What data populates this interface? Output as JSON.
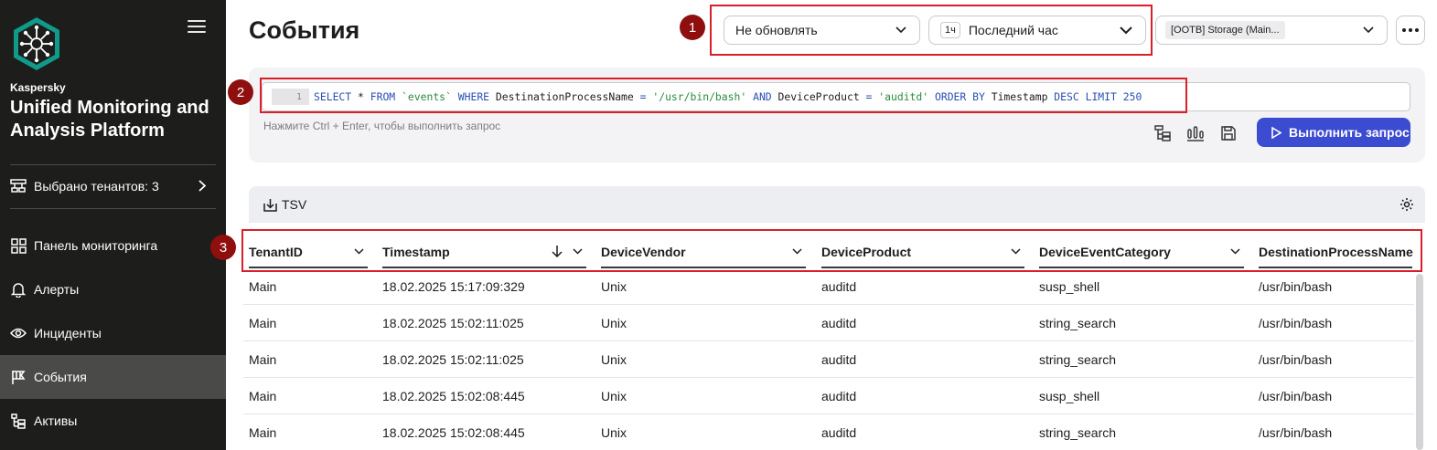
{
  "sidebar": {
    "brand_small": "Kaspersky",
    "brand_title": "Unified Monitoring and Analysis Platform",
    "tenant_label": "Выбрано тенантов: 3",
    "items": [
      {
        "label": "Панель мониторинга",
        "icon": "dashboard-icon"
      },
      {
        "label": "Алерты",
        "icon": "bell-icon"
      },
      {
        "label": "Инциденты",
        "icon": "eye-icon"
      },
      {
        "label": "События",
        "icon": "flag-icon",
        "active": true
      },
      {
        "label": "Активы",
        "icon": "tree-icon"
      }
    ]
  },
  "header": {
    "title": "События",
    "refresh_select": "Не обновлять",
    "period_badge": "1ч",
    "period_select": "Последний час",
    "storage_select": "[OOTB] Storage (Main..."
  },
  "query": {
    "line_number": "1",
    "tokens": [
      {
        "t": "SELECT",
        "k": "kw"
      },
      {
        "t": " * ",
        "k": "id"
      },
      {
        "t": "FROM",
        "k": "kw"
      },
      {
        "t": " `events` ",
        "k": "str"
      },
      {
        "t": "WHERE",
        "k": "kw"
      },
      {
        "t": " DestinationProcessName ",
        "k": "id"
      },
      {
        "t": "=",
        "k": "kw"
      },
      {
        "t": " '/usr/bin/bash' ",
        "k": "str"
      },
      {
        "t": "AND",
        "k": "kw"
      },
      {
        "t": " DeviceProduct ",
        "k": "id"
      },
      {
        "t": "=",
        "k": "kw"
      },
      {
        "t": " 'auditd' ",
        "k": "str"
      },
      {
        "t": "ORDER BY",
        "k": "kw"
      },
      {
        "t": " Timestamp ",
        "k": "id"
      },
      {
        "t": "DESC LIMIT 250",
        "k": "kw"
      }
    ],
    "hint": "Нажмите Ctrl + Enter, чтобы выполнить запрос",
    "run_label": "Выполнить запрос"
  },
  "results": {
    "export_label": "TSV",
    "columns": [
      "TenantID",
      "Timestamp",
      "DeviceVendor",
      "DeviceProduct",
      "DeviceEventCategory",
      "DestinationProcessName"
    ],
    "rows": [
      [
        "Main",
        "18.02.2025 15:17:09:329",
        "Unix",
        "auditd",
        "susp_shell",
        "/usr/bin/bash"
      ],
      [
        "Main",
        "18.02.2025 15:02:11:025",
        "Unix",
        "auditd",
        "string_search",
        "/usr/bin/bash"
      ],
      [
        "Main",
        "18.02.2025 15:02:11:025",
        "Unix",
        "auditd",
        "string_search",
        "/usr/bin/bash"
      ],
      [
        "Main",
        "18.02.2025 15:02:08:445",
        "Unix",
        "auditd",
        "susp_shell",
        "/usr/bin/bash"
      ],
      [
        "Main",
        "18.02.2025 15:02:08:445",
        "Unix",
        "auditd",
        "string_search",
        "/usr/bin/bash"
      ]
    ]
  },
  "annotations": [
    "1",
    "2",
    "3"
  ],
  "colors": {
    "accent": "#3c4cd1",
    "sidebar": "#1d1d1b",
    "annotation": "#d9202a"
  }
}
